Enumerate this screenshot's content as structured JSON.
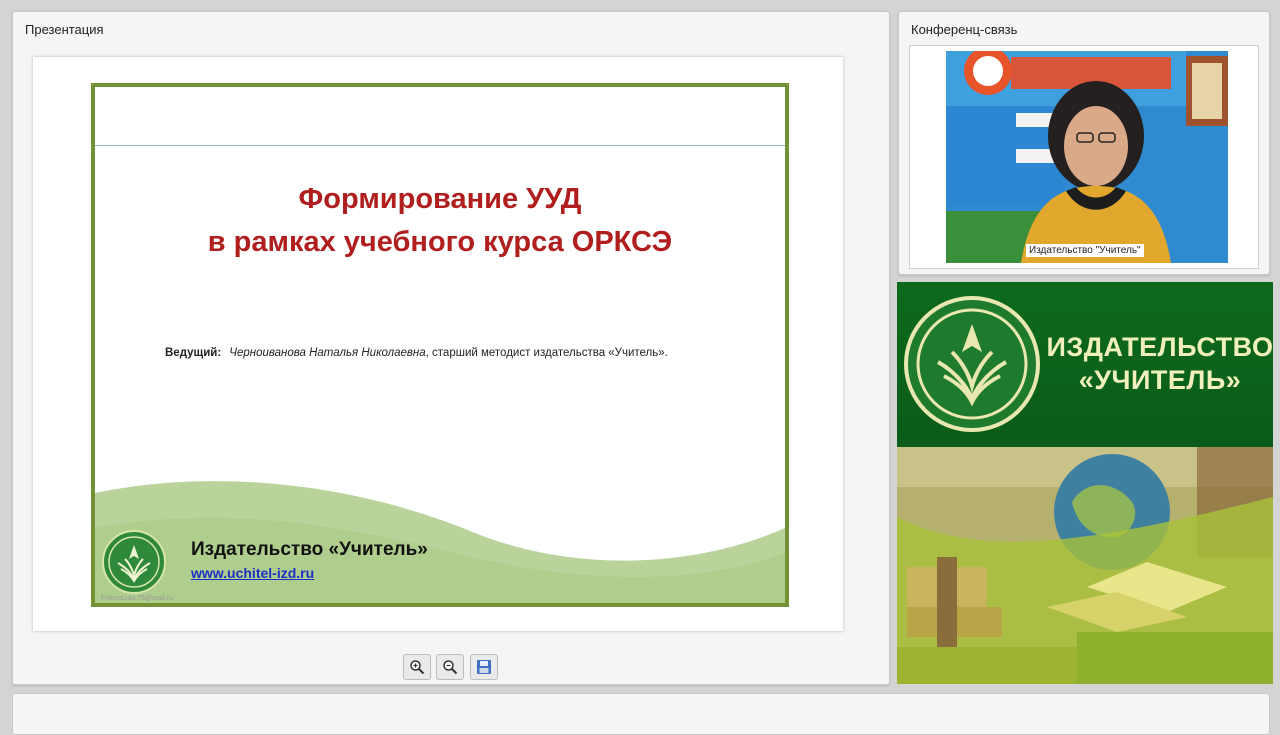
{
  "presentation": {
    "panel_title": "Презентация",
    "slide": {
      "title_line1": "Формирование УУД",
      "title_line2": "в рамках учебного курса ОРКСЭ",
      "presenter_label": "Ведущий:",
      "presenter_name": "Черноиванова Наталья Николаевна",
      "presenter_role": ", старший методист издательства «Учитель».",
      "publisher": "Издательство «Учитель»",
      "url": "www.uchitel-izd.ru",
      "watermark": "FokinaLida.75@mail.ru"
    },
    "toolbar": {
      "zoom_in": "zoom-in-icon",
      "zoom_out": "zoom-out-icon",
      "save": "save-icon"
    }
  },
  "conference": {
    "panel_title": "Конференц-связь",
    "video_label": "Издательство \"Учитель\""
  },
  "banner": {
    "title_line1": "ИЗДАТЕЛЬСТВО",
    "title_line2": "«УЧИТЕЛЬ»"
  },
  "colors": {
    "accent_green": "#739235",
    "title_red": "#b01e1e",
    "banner_green": "#0d6a1c",
    "banner_text": "#f1f0bc"
  }
}
